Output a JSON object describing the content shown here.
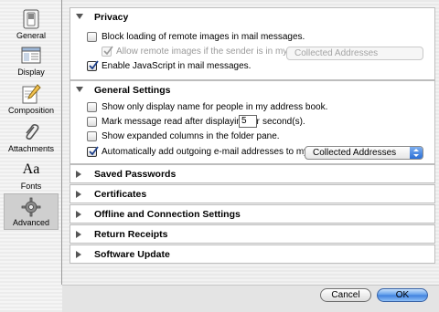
{
  "sidebar": {
    "items": [
      {
        "label": "General",
        "icon": "switch-icon"
      },
      {
        "label": "Display",
        "icon": "display-icon"
      },
      {
        "label": "Composition",
        "icon": "pencil-icon"
      },
      {
        "label": "Attachments",
        "icon": "paperclip-icon"
      },
      {
        "label": "Fonts",
        "icon": "fonts-icon"
      },
      {
        "label": "Advanced",
        "icon": "gear-icon"
      }
    ],
    "selected": "Advanced"
  },
  "privacy": {
    "title": "Privacy",
    "expanded": true,
    "block_images": {
      "label": "Block loading of remote images in mail messages.",
      "checked": false
    },
    "allow_images": {
      "label": "Allow remote images if the sender is in my:",
      "checked": true,
      "enabled": false
    },
    "allow_images_select": {
      "value": "Collected Addresses",
      "enabled": false
    },
    "enable_js": {
      "label": "Enable JavaScript in mail messages.",
      "checked": true
    }
  },
  "general_settings": {
    "title": "General Settings",
    "expanded": true,
    "show_display_name": {
      "label": "Show only display name for people in my address book.",
      "checked": false
    },
    "mark_read": {
      "label": "Mark message read after displaying for",
      "checked": false,
      "seconds": "5",
      "suffix": "second(s)."
    },
    "expanded_columns": {
      "label": "Show expanded columns in the folder pane.",
      "checked": false
    },
    "auto_add": {
      "label": "Automatically add outgoing e-mail addresses to my:",
      "checked": true
    },
    "auto_add_select": {
      "value": "Collected Addresses"
    }
  },
  "collapsed_sections": [
    {
      "title": "Saved Passwords"
    },
    {
      "title": "Certificates"
    },
    {
      "title": "Offline and Connection Settings"
    },
    {
      "title": "Return Receipts"
    },
    {
      "title": "Software Update"
    }
  ],
  "buttons": {
    "cancel": "Cancel",
    "ok": "OK"
  },
  "colors": {
    "default_button": "#3d7fdd",
    "selected_sidebar": "#cfcfcf"
  }
}
